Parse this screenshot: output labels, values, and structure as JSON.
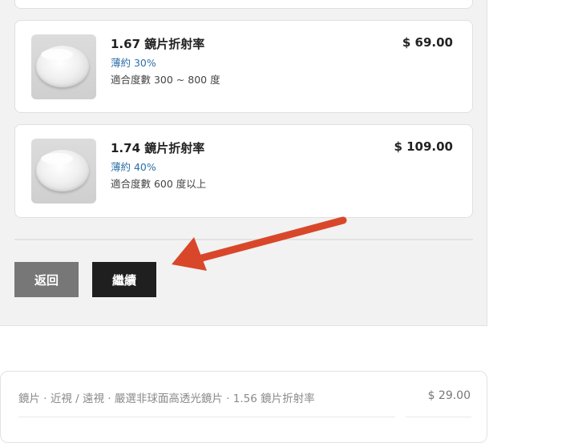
{
  "lens_options": [
    {
      "title": "1.67 鏡片折射率",
      "thinness": "薄約 30%",
      "range": "適合度數 300 ~ 800 度",
      "price": "$ 69.00"
    },
    {
      "title": "1.74 鏡片折射率",
      "thinness": "薄約 40%",
      "range": "適合度數 600 度以上",
      "price": "$ 109.00"
    }
  ],
  "actions": {
    "back_label": "返回",
    "continue_label": "繼續"
  },
  "summary": {
    "description": "鏡片 · 近視 / 遠視 · 嚴選非球面高透光鏡片 · 1.56 鏡片折射率",
    "price": "$ 29.00"
  },
  "colors": {
    "thin_text": "#2b6fa8",
    "arrow": "#d9472b",
    "continue_button": "#1f1f1f",
    "back_button": "#777777"
  }
}
